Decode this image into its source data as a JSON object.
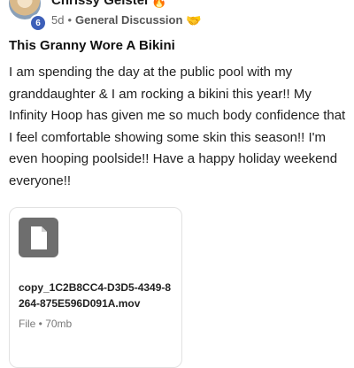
{
  "post": {
    "author_name": "Chrissy Geistel",
    "author_emoji": "🔥",
    "level": "6",
    "time_ago": "5d",
    "separator": "•",
    "space_name": "General Discussion",
    "space_emoji": "🤝",
    "title": "This Granny Wore A Bikini",
    "body": "I am spending the day at the public pool with my granddaughter & I am rocking a bikini this year!! My Infinity Hoop has given me so much body confidence that I feel comfortable showing some skin this season!! I'm even hooping poolside!! Have a happy holiday weekend everyone!!"
  },
  "attachment": {
    "icon": "file-icon",
    "file_name": "copy_1C2B8CC4-D3D5-4349-8264-875E596D091A.mov",
    "file_meta": "File • 70mb"
  }
}
